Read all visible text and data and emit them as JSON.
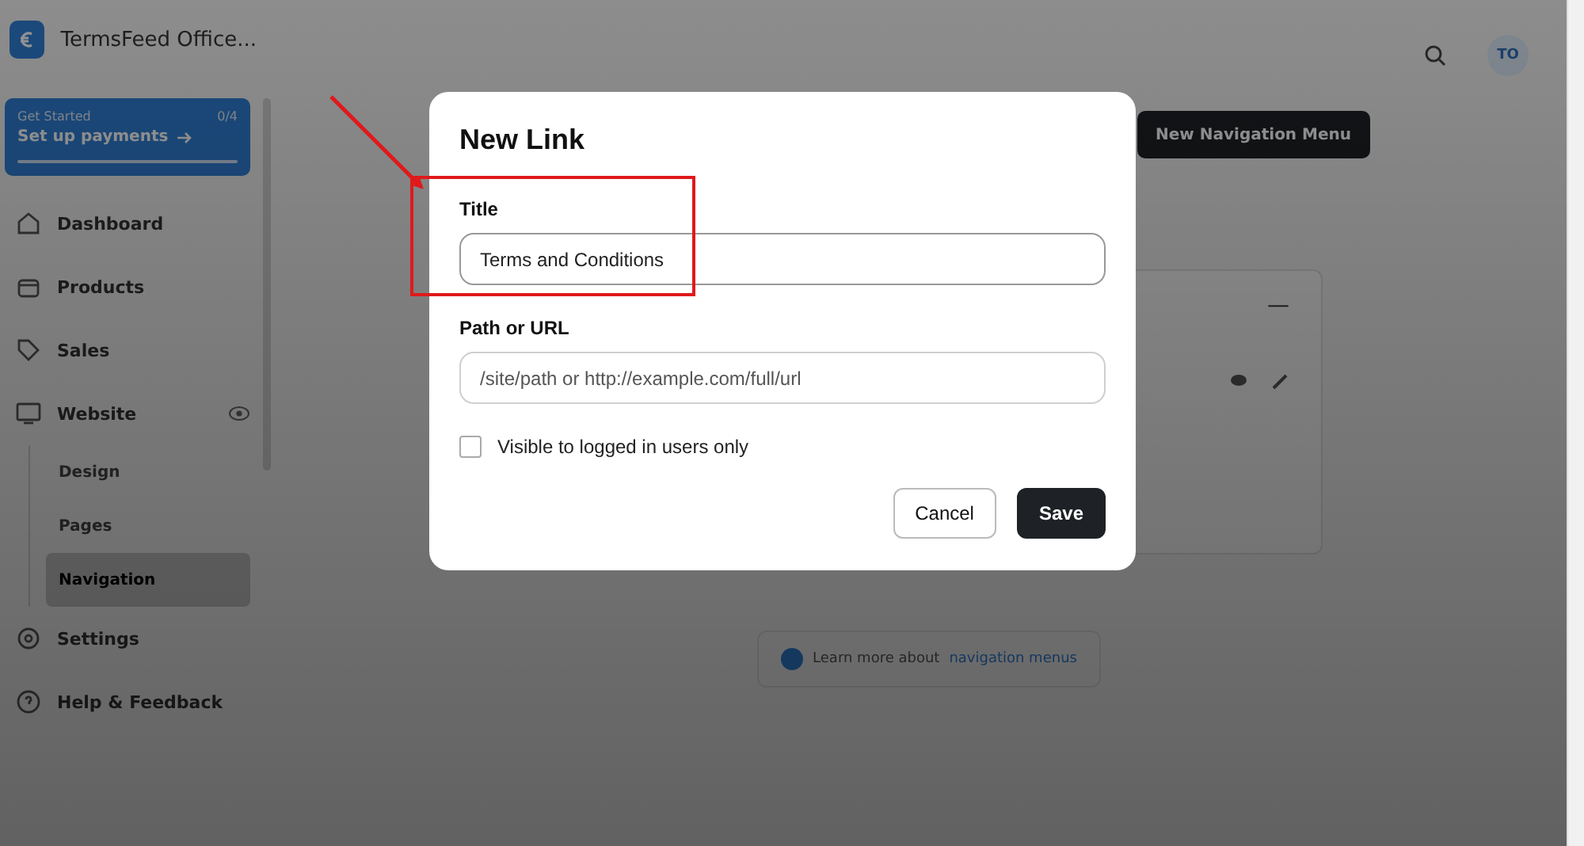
{
  "app": {
    "name": "TermsFeed Office..."
  },
  "get_started": {
    "label": "Get Started",
    "count": "0/4",
    "task": "Set up payments"
  },
  "sidebar": {
    "items": [
      {
        "label": "Dashboard",
        "selected": false
      },
      {
        "label": "Products",
        "selected": false
      },
      {
        "label": "Sales",
        "selected": false
      },
      {
        "label": "Website",
        "selected": false,
        "expanded": true,
        "children": [
          {
            "label": "Design",
            "selected": false
          },
          {
            "label": "Pages",
            "selected": false
          },
          {
            "label": "Navigation",
            "selected": true
          }
        ]
      },
      {
        "label": "Settings",
        "selected": false
      },
      {
        "label": "Help & Feedback",
        "selected": false
      }
    ]
  },
  "header": {
    "avatar": "TO"
  },
  "toolbar": {
    "new_button": "New Navigation Menu"
  },
  "menu_card": {
    "dash": "—"
  },
  "help": {
    "text": "Learn more about",
    "link": "navigation menus"
  },
  "dialog": {
    "title": "New Link",
    "fields": [
      {
        "label": "Title",
        "value": "Terms and Conditions",
        "focused": true
      },
      {
        "label": "Path or URL",
        "placeholder": "/site/path or http://example.com/full/url",
        "focused": false
      }
    ],
    "checkbox": {
      "label": "Visible to logged in users only",
      "checked": false
    },
    "buttons": [
      {
        "label": "Cancel",
        "kind": "secondary"
      },
      {
        "label": "Save",
        "kind": "primary"
      }
    ]
  }
}
